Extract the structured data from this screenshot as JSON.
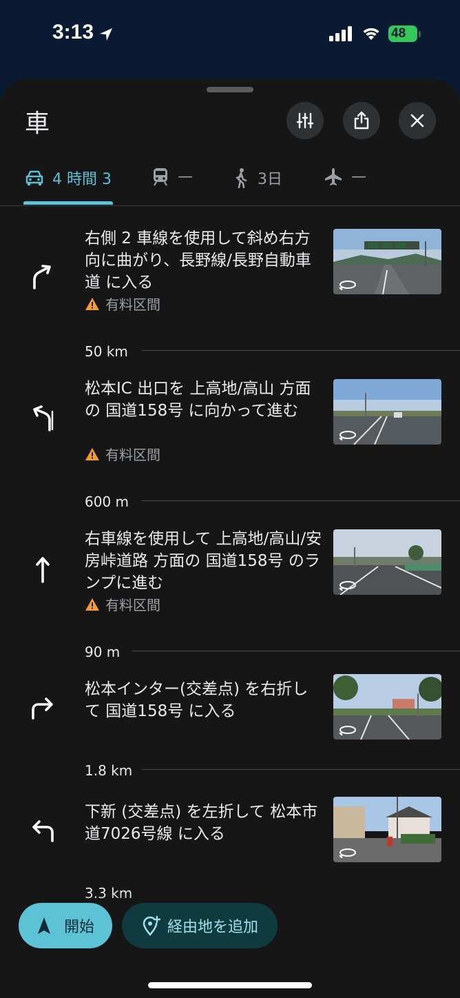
{
  "status_bar": {
    "time": "3:13",
    "battery": "48"
  },
  "sheet": {
    "title": "車"
  },
  "header_buttons": {
    "filter_icon": "sliders-icon",
    "share_icon": "share-icon",
    "close_icon": "close-icon"
  },
  "modes": [
    {
      "icon": "car-icon",
      "label": "4 時間 3",
      "active": true
    },
    {
      "icon": "train-icon",
      "label": "—",
      "active": false
    },
    {
      "icon": "walk-icon",
      "label": "3日",
      "active": false
    },
    {
      "icon": "flight-icon",
      "label": "—",
      "active": false
    }
  ],
  "steps": [
    {
      "icon": "turn-slight-right-icon",
      "text": "右側 2 車線を使用して斜め右方向に曲がり、長野線/長野自動車道 に入る",
      "note": "有料区間",
      "distance": "50 km"
    },
    {
      "icon": "exit-left-icon",
      "text": "松本IC 出口を 上高地/高山 方面の 国道158号 に向かって進む",
      "note": "有料区間",
      "distance": "600 m"
    },
    {
      "icon": "straight-icon",
      "text": "右車線を使用して 上高地/高山/安房峠道路 方面の 国道158号 のランプに進む",
      "note": "有料区間",
      "distance": "90 m"
    },
    {
      "icon": "turn-right-icon",
      "text": "松本インター(交差点) を右折して 国道158号 に入る",
      "note": "",
      "distance": "1.8 km"
    },
    {
      "icon": "turn-left-icon",
      "text": "下新 (交差点) を左折して 松本市道7026号線 に入る",
      "note": "",
      "distance": "3.3 km"
    }
  ],
  "actions": {
    "start_label": "開始",
    "add_waypoint_label": "経由地を追加"
  },
  "colors": {
    "accent": "#5cc2d6",
    "sheet_bg": "#161616",
    "warning": "#f29b3a"
  }
}
